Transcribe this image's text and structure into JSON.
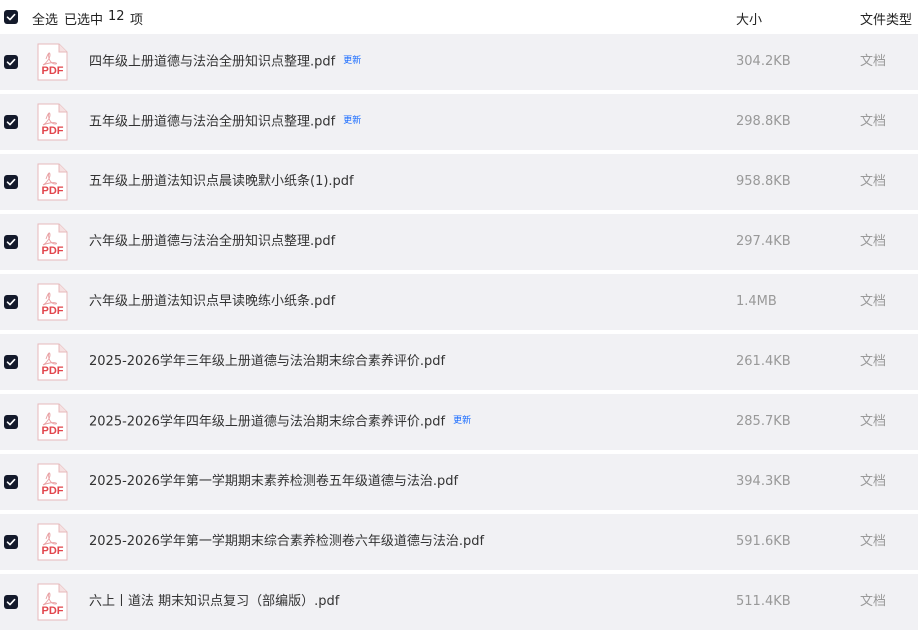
{
  "header": {
    "select_all": "全选",
    "selected_label": "已选中",
    "selected_count": "12",
    "selected_unit": "项",
    "col_size": "大小",
    "col_type": "文件类型"
  },
  "icons": {
    "checkbox": "checkbox-checked-icon",
    "file": "pdf-file-icon"
  },
  "colors": {
    "checkbox": "#141a2b",
    "row_bg": "#f1f1f4",
    "badge": "#1a6cff",
    "pdf_red": "#e2454c"
  },
  "files": [
    {
      "name": "四年级上册道德与法治全册知识点整理.pdf",
      "badge": "更新",
      "size": "304.2KB",
      "type": "文档"
    },
    {
      "name": "五年级上册道德与法治全册知识点整理.pdf",
      "badge": "更新",
      "size": "298.8KB",
      "type": "文档"
    },
    {
      "name": "五年级上册道法知识点晨读晚默小纸条(1).pdf",
      "badge": "",
      "size": "958.8KB",
      "type": "文档"
    },
    {
      "name": "六年级上册道德与法治全册知识点整理.pdf",
      "badge": "",
      "size": "297.4KB",
      "type": "文档"
    },
    {
      "name": "六年级上册道法知识点早读晚练小纸条.pdf",
      "badge": "",
      "size": "1.4MB",
      "type": "文档"
    },
    {
      "name": "2025-2026学年三年级上册道德与法治期末综合素养评价.pdf",
      "badge": "",
      "size": "261.4KB",
      "type": "文档"
    },
    {
      "name": "2025-2026学年四年级上册道德与法治期末综合素养评价.pdf",
      "badge": "更新",
      "size": "285.7KB",
      "type": "文档"
    },
    {
      "name": "2025-2026学年第一学期期末素养检测卷五年级道德与法治.pdf",
      "badge": "",
      "size": "394.3KB",
      "type": "文档"
    },
    {
      "name": "2025-2026学年第一学期期末综合素养检测卷六年级道德与法治.pdf",
      "badge": "",
      "size": "591.6KB",
      "type": "文档"
    },
    {
      "name": "六上丨道法 期末知识点复习（部编版）.pdf",
      "badge": "",
      "size": "511.4KB",
      "type": "文档"
    }
  ],
  "pdf_label": "PDF"
}
